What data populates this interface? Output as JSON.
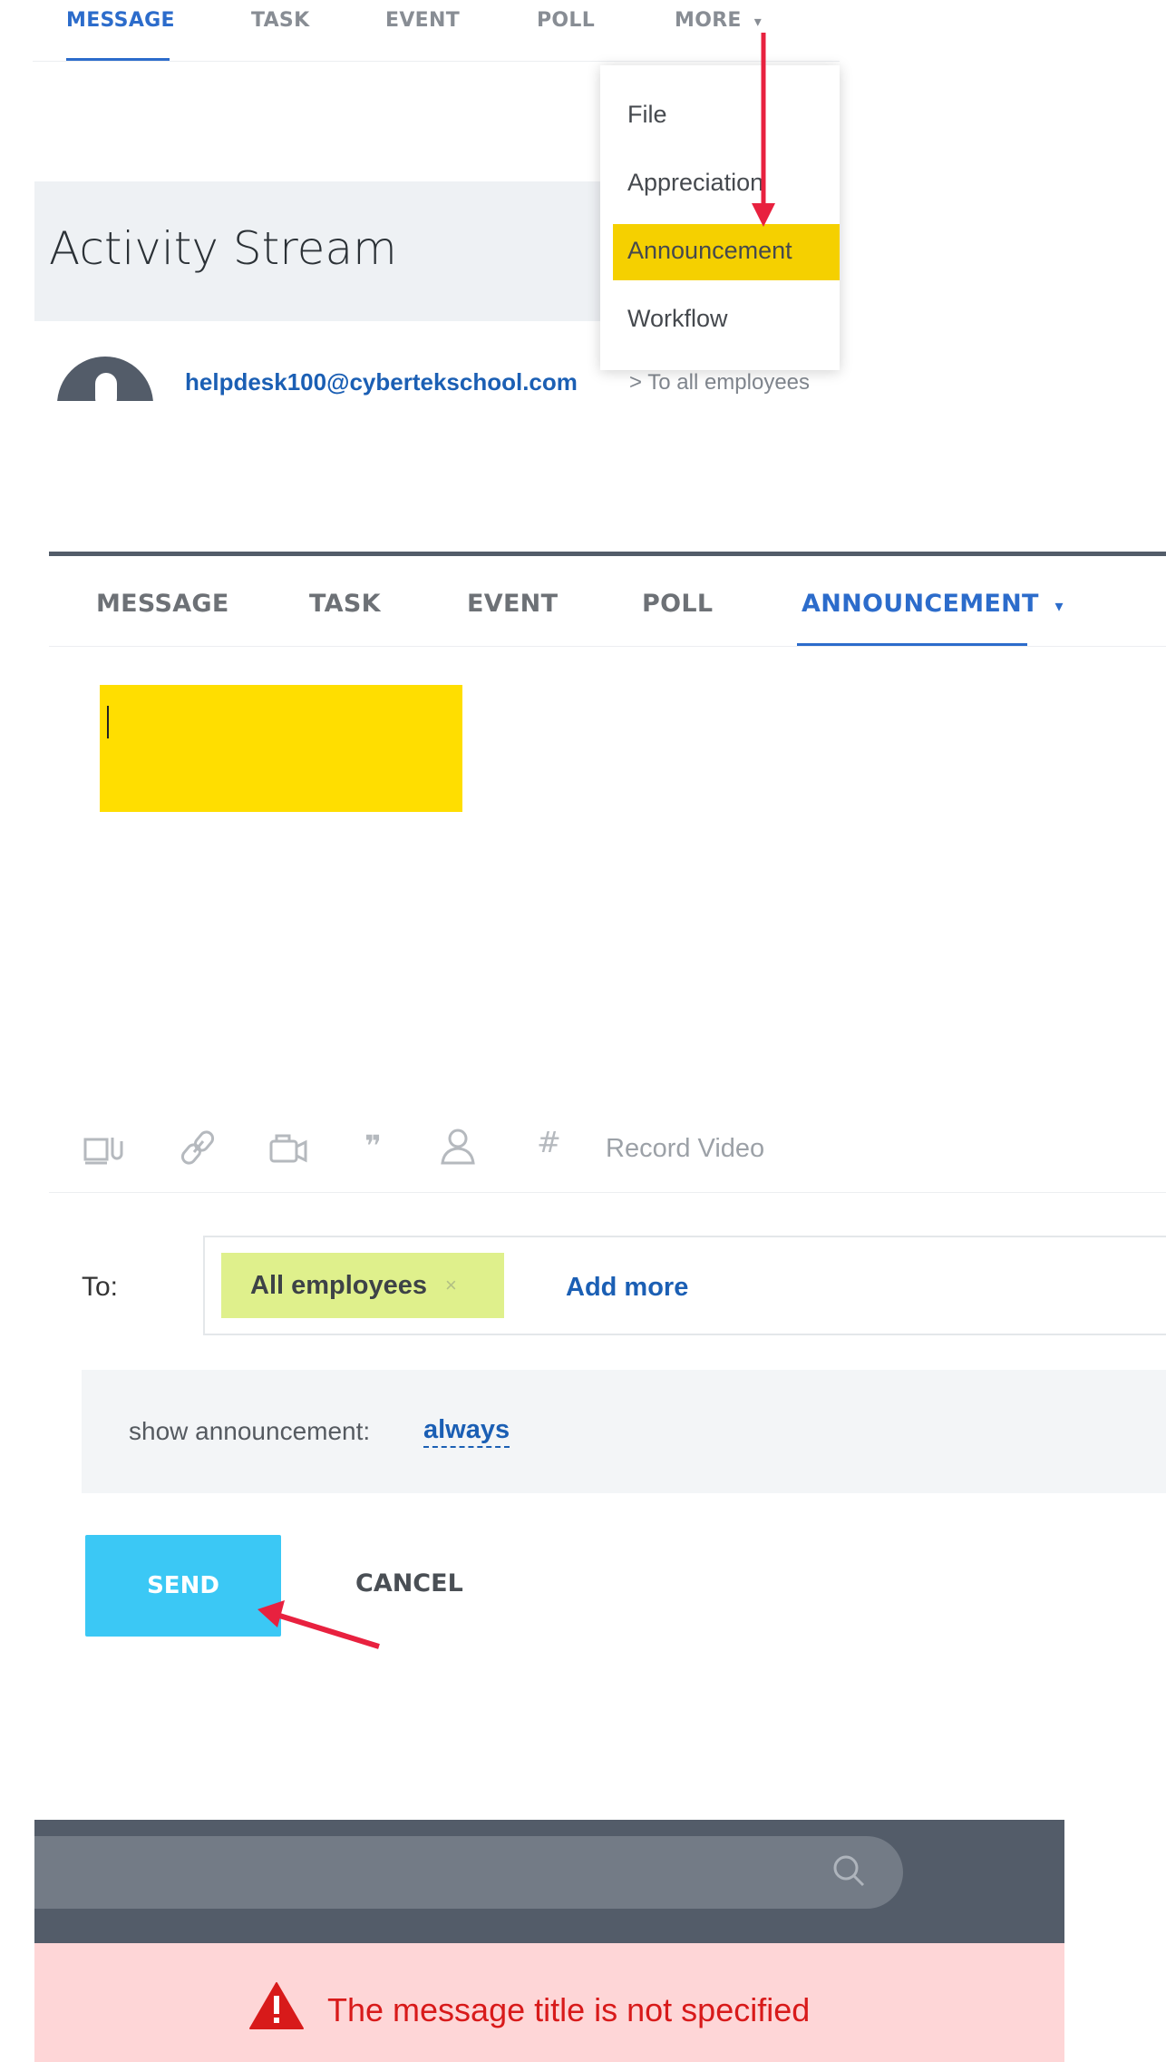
{
  "panel1": {
    "tabs": [
      "MESSAGE",
      "TASK",
      "EVENT",
      "POLL",
      "MORE"
    ],
    "active_tab": "MESSAGE",
    "more_caret": "▾",
    "activity_title": "Activity Stream",
    "menu_items": [
      "File",
      "Appreciation",
      "Announcement",
      "Workflow"
    ],
    "highlighted_item": "Announcement",
    "post": {
      "author": "helpdesk100@cybertekschool.com",
      "recipient": "> To all employees"
    }
  },
  "panel2": {
    "tabs": [
      "MESSAGE",
      "TASK",
      "EVENT",
      "POLL",
      "ANNOUNCEMENT"
    ],
    "active_tab": "ANNOUNCEMENT",
    "dropdown_caret": "▾",
    "record_video": "Record Video",
    "to_label": "To:",
    "recipient_chip": "All employees",
    "chip_remove": "×",
    "add_more": "Add more",
    "show_announcement_label": "show announcement:",
    "show_announcement_value": "always",
    "send_label": "SEND",
    "cancel_label": "CANCEL"
  },
  "panel3": {
    "error_message": "The message title is not specified"
  },
  "colors": {
    "accent_blue": "#2c6ccb",
    "highlight_yellow": "#ffde00",
    "send_button": "#3bc8f5",
    "chip_green": "#dff08c",
    "error_bg": "#fed6d7",
    "error_text": "#d81a1a",
    "header_dark": "#535c69",
    "annotation_arrow": "#e8213f"
  },
  "icons": [
    "attach-file-icon",
    "link-icon",
    "video-camera-icon",
    "quote-icon",
    "mention-user-icon",
    "hashtag-icon",
    "search-icon",
    "warning-icon"
  ]
}
